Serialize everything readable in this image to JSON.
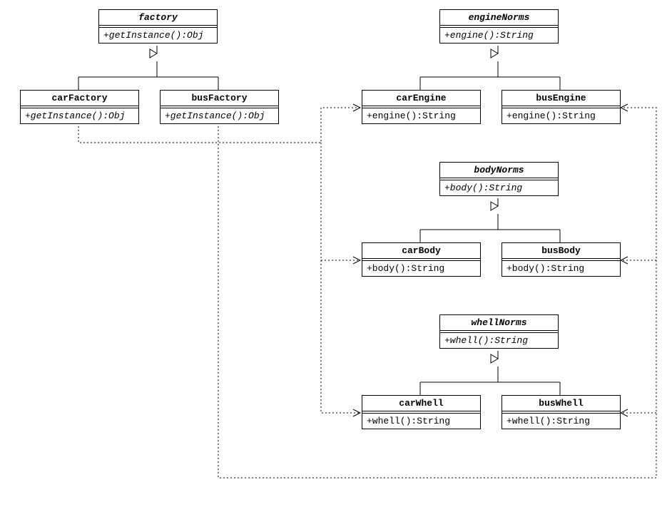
{
  "classes": {
    "factory": {
      "name": "factory",
      "method": "+getInstance():Obj",
      "abstract": true
    },
    "carFactory": {
      "name": "carFactory",
      "method": "+getInstance():Obj",
      "abstract": false,
      "methodItalic": true
    },
    "busFactory": {
      "name": "busFactory",
      "method": "+getInstance():Obj",
      "abstract": false,
      "methodItalic": true
    },
    "engineNorms": {
      "name": "engineNorms",
      "method": "+engine():String",
      "abstract": true
    },
    "carEngine": {
      "name": "carEngine",
      "method": "+engine():String",
      "abstract": false
    },
    "busEngine": {
      "name": "busEngine",
      "method": "+engine():String",
      "abstract": false
    },
    "bodyNorms": {
      "name": "bodyNorms",
      "method": "+body():String",
      "abstract": true
    },
    "carBody": {
      "name": "carBody",
      "method": "+body():String",
      "abstract": false
    },
    "busBody": {
      "name": "busBody",
      "method": "+body():String",
      "abstract": false
    },
    "whellNorms": {
      "name": "whellNorms",
      "method": "+whell():String",
      "abstract": true
    },
    "carWhell": {
      "name": "carWhell",
      "method": "+whell():String",
      "abstract": false
    },
    "busWhell": {
      "name": "busWhell",
      "method": "+whell():String",
      "abstract": false
    }
  },
  "relations": {
    "inheritance": [
      {
        "child": "carFactory",
        "parent": "factory"
      },
      {
        "child": "busFactory",
        "parent": "factory"
      },
      {
        "child": "carEngine",
        "parent": "engineNorms"
      },
      {
        "child": "busEngine",
        "parent": "engineNorms"
      },
      {
        "child": "carBody",
        "parent": "bodyNorms"
      },
      {
        "child": "busBody",
        "parent": "bodyNorms"
      },
      {
        "child": "carWhell",
        "parent": "whellNorms"
      },
      {
        "child": "busWhell",
        "parent": "whellNorms"
      }
    ],
    "dependency": [
      {
        "from": "carFactory",
        "to": "carEngine"
      },
      {
        "from": "carFactory",
        "to": "carBody"
      },
      {
        "from": "carFactory",
        "to": "carWhell"
      },
      {
        "from": "busFactory",
        "to": "busEngine"
      },
      {
        "from": "busFactory",
        "to": "busBody"
      },
      {
        "from": "busFactory",
        "to": "busWhell"
      }
    ]
  }
}
